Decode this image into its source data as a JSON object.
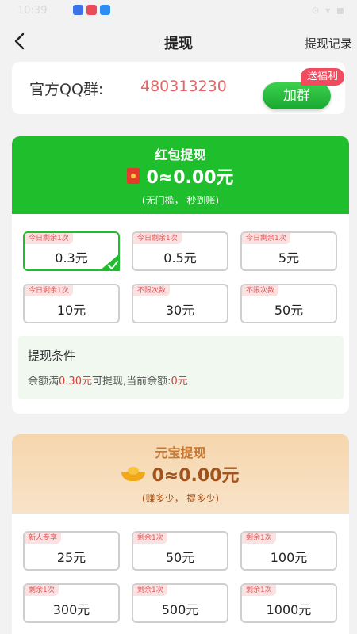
{
  "status_bar": {
    "time": "10:39",
    "right": "⊙ ▾ ◼"
  },
  "header": {
    "title": "提现",
    "record": "提现记录"
  },
  "qq_group": {
    "label": "官方QQ群:",
    "number": "480313230",
    "join_button": "加群",
    "badge": "送福利"
  },
  "red_packet": {
    "title": "红包提现",
    "amount": "0≈0.00元",
    "subtitle": "(无门槛， 秒到账)",
    "options": [
      {
        "tag": "今日剩余1次",
        "value": "0.3元",
        "selected": true
      },
      {
        "tag": "今日剩余1次",
        "value": "0.5元",
        "selected": false
      },
      {
        "tag": "今日剩余1次",
        "value": "5元",
        "selected": false
      },
      {
        "tag": "今日剩余1次",
        "value": "10元",
        "selected": false
      },
      {
        "tag": "不限次数",
        "value": "30元",
        "selected": false
      },
      {
        "tag": "不限次数",
        "value": "50元",
        "selected": false
      }
    ],
    "condition": {
      "title": "提现条件",
      "text_prefix": "余额满",
      "text_threshold": "0.30元",
      "text_middle": "可提现,当前余额:",
      "text_balance": "0元"
    }
  },
  "ingot": {
    "title": "元宝提现",
    "amount": "0≈0.00元",
    "subtitle": "(赚多少， 提多少)",
    "options": [
      {
        "tag": "新人专享",
        "value": "25元"
      },
      {
        "tag": "剩余1次",
        "value": "50元"
      },
      {
        "tag": "剩余1次",
        "value": "100元"
      },
      {
        "tag": "剩余1次",
        "value": "300元"
      },
      {
        "tag": "剩余1次",
        "value": "500元"
      },
      {
        "tag": "剩余1次",
        "value": "1000元"
      }
    ]
  },
  "colors": {
    "green": "#1fbe2d",
    "red": "#f24a5e",
    "ingot_bg": "#f6d6ad"
  }
}
